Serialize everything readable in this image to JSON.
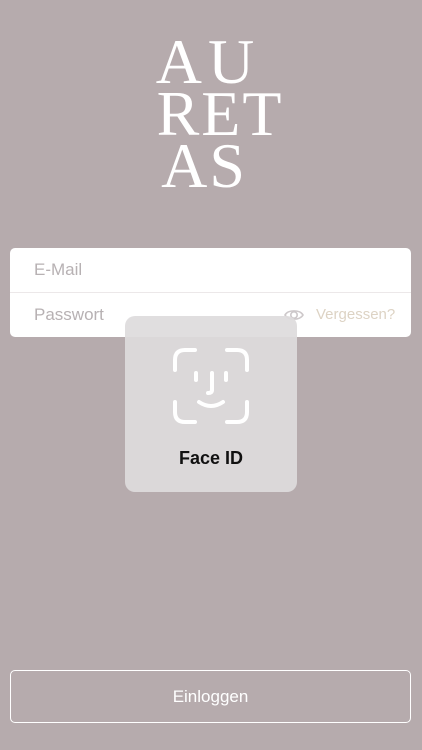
{
  "brand": {
    "logo_lines": [
      "AU",
      "RET",
      "AS"
    ]
  },
  "login": {
    "email_placeholder": "E-Mail",
    "password_placeholder": "Passwort",
    "show_password_icon": "eye-icon",
    "forgot_label": "Vergessen?",
    "submit_label": "Einloggen"
  },
  "faceid": {
    "icon": "face-id-icon",
    "label": "Face ID"
  },
  "colors": {
    "background": "#b6abad",
    "card": "#ffffff",
    "forgot_link": "#ddd3c4",
    "hud": "#dedbdd"
  }
}
